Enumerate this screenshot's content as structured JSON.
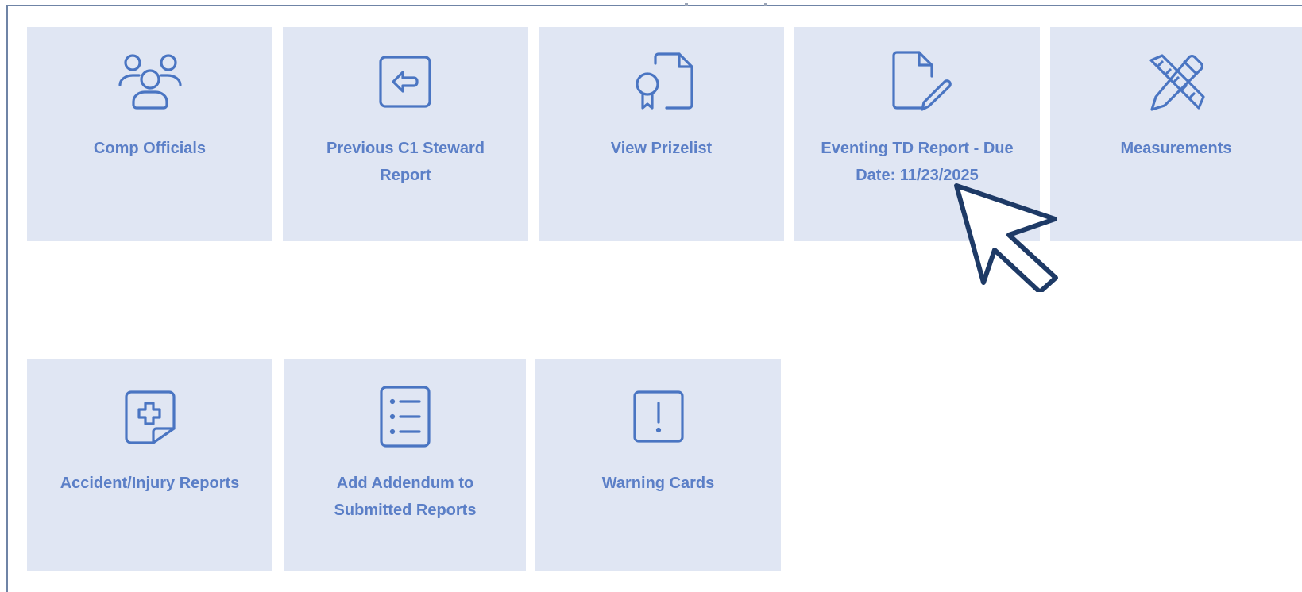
{
  "tiles": [
    {
      "label": "Comp Officials",
      "icon": "people-group-icon"
    },
    {
      "label": "Previous C1 Steward Report",
      "icon": "back-arrow-icon"
    },
    {
      "label": "View Prizelist",
      "icon": "certificate-document-icon"
    },
    {
      "label": "Eventing TD Report - Due Date: 11/23/2025",
      "icon": "document-edit-icon"
    },
    {
      "label": "Measurements",
      "icon": "ruler-pencil-icon"
    },
    {
      "label": "Accident/Injury Reports",
      "icon": "medical-note-icon"
    },
    {
      "label": "Add Addendum to Submitted Reports",
      "icon": "list-icon"
    },
    {
      "label": "Warning Cards",
      "icon": "exclamation-icon"
    }
  ],
  "colors": {
    "tile_background": "#e0e6f3",
    "accent": "#4a75c2",
    "label": "#5b7fc7",
    "cursor_stroke": "#1e3a66"
  }
}
